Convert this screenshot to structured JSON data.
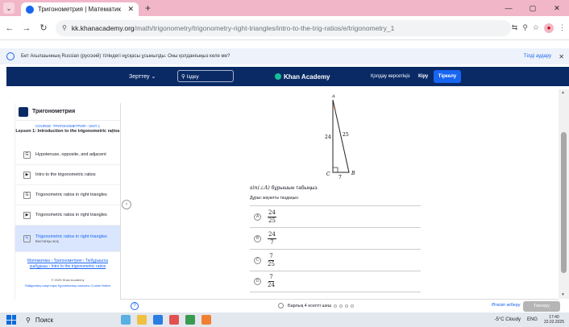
{
  "browser": {
    "tab_title": "Тригонометрия | Математик",
    "tab_close": "✕",
    "new_tab": "+",
    "url_domain": "kk.khanacademy.org",
    "url_path": "/math/trigonometry/trigonometry-right-triangles/intro-to-the-trig-ratios/e/trigonometry_1",
    "window_controls": [
      "—",
      "▢",
      "✕"
    ]
  },
  "translate_bar": {
    "message": "Бет Ағылшынның Russian (русский) тіліндегі нұсқасы ұсынылды. Оны қолданғыңыз келе ме?",
    "never": "Тілді аудару",
    "close": "✕"
  },
  "ka_nav": {
    "explore": "Зерттеу ⌄",
    "search": "Іздеу",
    "logo": "Khan Academy",
    "donate": "Қолдау көрсетіңіз",
    "login": "Кіру",
    "signup": "Тіркелу"
  },
  "sidebar": {
    "course_title": "Тригонометрия",
    "course_crumb": "COURSE: ТРИГОНОМЕТРИЯ › UNIT 1",
    "lesson_title": "Lesson 1: Introduction to the trigonometric ratios",
    "items": [
      {
        "label": "Hypotenuse, opposite, and adjacent",
        "icon": "G"
      },
      {
        "label": "Intro to the trigonometric ratios",
        "icon": "▶"
      },
      {
        "label": "Trigonometric ratios in right triangles",
        "icon": "G"
      },
      {
        "label": "Trigonometric ratios in right triangles",
        "icon": "▶"
      },
      {
        "label": "Trigonometric ratios in right triangles",
        "icon": "✎",
        "sub": "Бастапқы жоқ"
      }
    ],
    "breadcrumbs": "Математика › Тригонометрия › Тікбұрышты үшбұрыш › Intro to the trigonometric ratios",
    "copyright": "© 2025 Khan Academy",
    "footer_links": "Пайдалану шарттары  Құпиялылық саясаты  Cookie Notice"
  },
  "exercise": {
    "labels": {
      "top": "A",
      "side_left": "24",
      "side_right": "25",
      "bottom": "7",
      "c": "C",
      "b": "B"
    },
    "question_prefix": "sin(∠A)",
    "question_suffix": "бұрышын табыңыз.",
    "instruction": "Дұрыс жауапты таңдаңыз:",
    "choices": [
      {
        "letter": "A",
        "num": "24",
        "den": "25"
      },
      {
        "letter": "B",
        "num": "24",
        "den": "7"
      },
      {
        "letter": "C",
        "num": "7",
        "den": "25"
      },
      {
        "letter": "D",
        "num": "7",
        "den": "24"
      }
    ]
  },
  "footer": {
    "progress": "Барлық 4 есепті шеш",
    "skip": "Өткізіп жіберу",
    "check": "Тексеру"
  },
  "taskbar": {
    "search": "Поиск",
    "weather": "-5°C Cloudy",
    "lang": "ENG",
    "time": "17:40",
    "date": "22.02.2025"
  }
}
